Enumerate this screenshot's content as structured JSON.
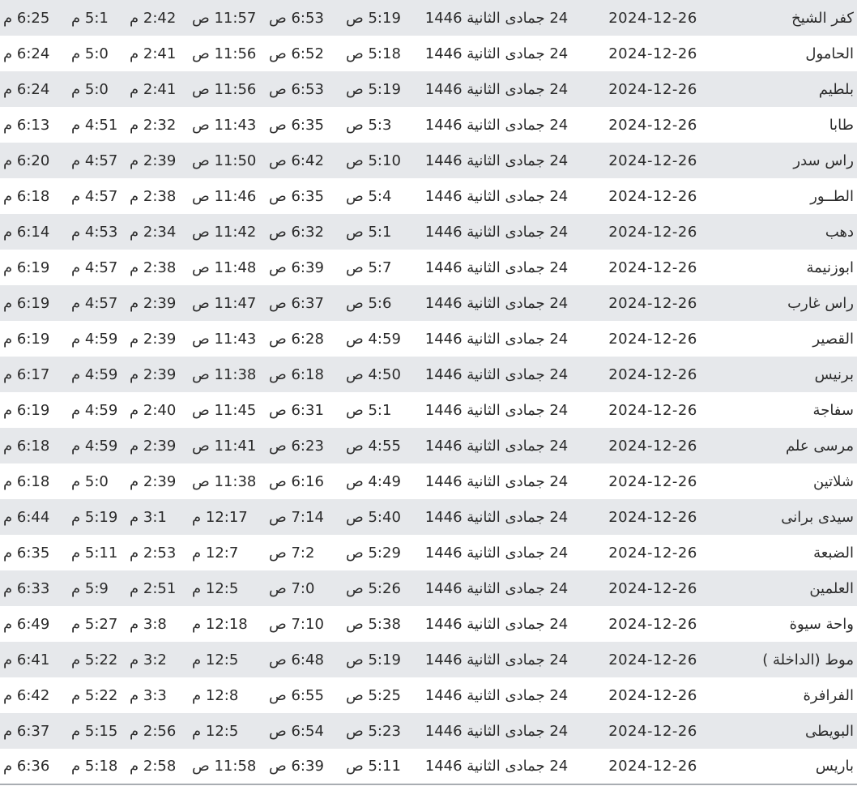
{
  "rows": [
    {
      "city": "كفر الشيخ",
      "gregorian": "2024-12-26",
      "hijri": "24 جمادى الثانية 1446",
      "fajr": "5:19 ص",
      "sunrise": "6:53 ص",
      "dhuhr": "11:57 ص",
      "asr": "2:42 م",
      "maghrib": "5:1 م",
      "isha": "6:25 م"
    },
    {
      "city": "الحامول",
      "gregorian": "2024-12-26",
      "hijri": "24 جمادى الثانية 1446",
      "fajr": "5:18 ص",
      "sunrise": "6:52 ص",
      "dhuhr": "11:56 ص",
      "asr": "2:41 م",
      "maghrib": "5:0 م",
      "isha": "6:24 م"
    },
    {
      "city": "بلطيم",
      "gregorian": "2024-12-26",
      "hijri": "24 جمادى الثانية 1446",
      "fajr": "5:19 ص",
      "sunrise": "6:53 ص",
      "dhuhr": "11:56 ص",
      "asr": "2:41 م",
      "maghrib": "5:0 م",
      "isha": "6:24 م"
    },
    {
      "city": "طابا",
      "gregorian": "2024-12-26",
      "hijri": "24 جمادى الثانية 1446",
      "fajr": "5:3 ص",
      "sunrise": "6:35 ص",
      "dhuhr": "11:43 ص",
      "asr": "2:32 م",
      "maghrib": "4:51 م",
      "isha": "6:13 م"
    },
    {
      "city": "راس سدر",
      "gregorian": "2024-12-26",
      "hijri": "24 جمادى الثانية 1446",
      "fajr": "5:10 ص",
      "sunrise": "6:42 ص",
      "dhuhr": "11:50 ص",
      "asr": "2:39 م",
      "maghrib": "4:57 م",
      "isha": "6:20 م"
    },
    {
      "city": "الطــور",
      "gregorian": "2024-12-26",
      "hijri": "24 جمادى الثانية 1446",
      "fajr": "5:4 ص",
      "sunrise": "6:35 ص",
      "dhuhr": "11:46 ص",
      "asr": "2:38 م",
      "maghrib": "4:57 م",
      "isha": "6:18 م"
    },
    {
      "city": "دهب",
      "gregorian": "2024-12-26",
      "hijri": "24 جمادى الثانية 1446",
      "fajr": "5:1 ص",
      "sunrise": "6:32 ص",
      "dhuhr": "11:42 ص",
      "asr": "2:34 م",
      "maghrib": "4:53 م",
      "isha": "6:14 م"
    },
    {
      "city": "ابوزنيمة",
      "gregorian": "2024-12-26",
      "hijri": "24 جمادى الثانية 1446",
      "fajr": "5:7 ص",
      "sunrise": "6:39 ص",
      "dhuhr": "11:48 ص",
      "asr": "2:38 م",
      "maghrib": "4:57 م",
      "isha": "6:19 م"
    },
    {
      "city": "راس غارب",
      "gregorian": "2024-12-26",
      "hijri": "24 جمادى الثانية 1446",
      "fajr": "5:6 ص",
      "sunrise": "6:37 ص",
      "dhuhr": "11:47 ص",
      "asr": "2:39 م",
      "maghrib": "4:57 م",
      "isha": "6:19 م"
    },
    {
      "city": "القصير",
      "gregorian": "2024-12-26",
      "hijri": "24 جمادى الثانية 1446",
      "fajr": "4:59 ص",
      "sunrise": "6:28 ص",
      "dhuhr": "11:43 ص",
      "asr": "2:39 م",
      "maghrib": "4:59 م",
      "isha": "6:19 م"
    },
    {
      "city": "برنيس",
      "gregorian": "2024-12-26",
      "hijri": "24 جمادى الثانية 1446",
      "fajr": "4:50 ص",
      "sunrise": "6:18 ص",
      "dhuhr": "11:38 ص",
      "asr": "2:39 م",
      "maghrib": "4:59 م",
      "isha": "6:17 م"
    },
    {
      "city": "سفاجة",
      "gregorian": "2024-12-26",
      "hijri": "24 جمادى الثانية 1446",
      "fajr": "5:1 ص",
      "sunrise": "6:31 ص",
      "dhuhr": "11:45 ص",
      "asr": "2:40 م",
      "maghrib": "4:59 م",
      "isha": "6:19 م"
    },
    {
      "city": "مرسى علم",
      "gregorian": "2024-12-26",
      "hijri": "24 جمادى الثانية 1446",
      "fajr": "4:55 ص",
      "sunrise": "6:23 ص",
      "dhuhr": "11:41 ص",
      "asr": "2:39 م",
      "maghrib": "4:59 م",
      "isha": "6:18 م"
    },
    {
      "city": "شلاتين",
      "gregorian": "2024-12-26",
      "hijri": "24 جمادى الثانية 1446",
      "fajr": "4:49 ص",
      "sunrise": "6:16 ص",
      "dhuhr": "11:38 ص",
      "asr": "2:39 م",
      "maghrib": "5:0 م",
      "isha": "6:18 م"
    },
    {
      "city": "سيدى برانى",
      "gregorian": "2024-12-26",
      "hijri": "24 جمادى الثانية 1446",
      "fajr": "5:40 ص",
      "sunrise": "7:14 ص",
      "dhuhr": "12:17 م",
      "asr": "3:1 م",
      "maghrib": "5:19 م",
      "isha": "6:44 م"
    },
    {
      "city": "الضبعة",
      "gregorian": "2024-12-26",
      "hijri": "24 جمادى الثانية 1446",
      "fajr": "5:29 ص",
      "sunrise": "7:2 ص",
      "dhuhr": "12:7 م",
      "asr": "2:53 م",
      "maghrib": "5:11 م",
      "isha": "6:35 م"
    },
    {
      "city": "العلمين",
      "gregorian": "2024-12-26",
      "hijri": "24 جمادى الثانية 1446",
      "fajr": "5:26 ص",
      "sunrise": "7:0 ص",
      "dhuhr": "12:5 م",
      "asr": "2:51 م",
      "maghrib": "5:9 م",
      "isha": "6:33 م"
    },
    {
      "city": "واحة سيوة",
      "gregorian": "2024-12-26",
      "hijri": "24 جمادى الثانية 1446",
      "fajr": "5:38 ص",
      "sunrise": "7:10 ص",
      "dhuhr": "12:18 م",
      "asr": "3:8 م",
      "maghrib": "5:27 م",
      "isha": "6:49 م"
    },
    {
      "city": "موط (الداخلة )",
      "gregorian": "2024-12-26",
      "hijri": "24 جمادى الثانية 1446",
      "fajr": "5:19 ص",
      "sunrise": "6:48 ص",
      "dhuhr": "12:5 م",
      "asr": "3:2 م",
      "maghrib": "5:22 م",
      "isha": "6:41 م"
    },
    {
      "city": "الفرافرة",
      "gregorian": "2024-12-26",
      "hijri": "24 جمادى الثانية 1446",
      "fajr": "5:25 ص",
      "sunrise": "6:55 ص",
      "dhuhr": "12:8 م",
      "asr": "3:3 م",
      "maghrib": "5:22 م",
      "isha": "6:42 م"
    },
    {
      "city": "البويطى",
      "gregorian": "2024-12-26",
      "hijri": "24 جمادى الثانية 1446",
      "fajr": "5:23 ص",
      "sunrise": "6:54 ص",
      "dhuhr": "12:5 م",
      "asr": "2:56 م",
      "maghrib": "5:15 م",
      "isha": "6:37 م"
    },
    {
      "city": "باريس",
      "gregorian": "2024-12-26",
      "hijri": "24 جمادى الثانية 1446",
      "fajr": "5:11 ص",
      "sunrise": "6:39 ص",
      "dhuhr": "11:58 ص",
      "asr": "2:58 م",
      "maghrib": "5:18 م",
      "isha": "6:36 م"
    }
  ]
}
